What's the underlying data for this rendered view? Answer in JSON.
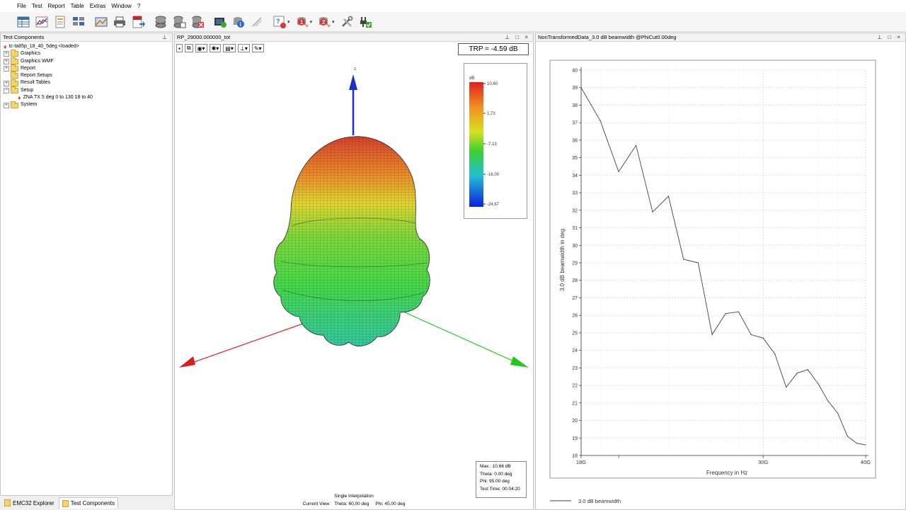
{
  "menu": [
    "File",
    "Test",
    "Report",
    "Table",
    "Extras",
    "Window",
    "?"
  ],
  "toolbar": {
    "icons": [
      "table-icon",
      "line-chart-icon",
      "report-icon",
      "tree-table-icon",
      "image-chart-icon",
      "print-icon",
      "export-pdf-icon",
      "database-icon",
      "database-edit-icon",
      "database-delete-icon",
      "monitor-run-icon",
      "info-db-icon",
      "signal-icon",
      "checklist-icon",
      "step-one-icon",
      "step-two-icon",
      "tools-icon",
      "plug-icon"
    ]
  },
  "left_panel": {
    "title": "Test Components",
    "tree": [
      {
        "label": "tc-ta85p_18_40_5deg <loaded>",
        "level": 0,
        "type": "root"
      },
      {
        "label": "Graphics",
        "level": 0,
        "type": "folder",
        "expander": "+"
      },
      {
        "label": "Graphics WMF",
        "level": 0,
        "type": "folder",
        "expander": "+"
      },
      {
        "label": "Report",
        "level": 0,
        "type": "folder",
        "expander": "+"
      },
      {
        "label": "Report Setups",
        "level": 0,
        "type": "folder",
        "expander": ""
      },
      {
        "label": "Result Tables",
        "level": 0,
        "type": "folder",
        "expander": "+"
      },
      {
        "label": "Setup",
        "level": 0,
        "type": "folder",
        "expander": "−"
      },
      {
        "label": "ZNA TX 5 deg 0 to 130 18 to 40",
        "level": 1,
        "type": "root"
      },
      {
        "label": "System",
        "level": 0,
        "type": "folder",
        "expander": "+"
      }
    ],
    "tabs": [
      "EMC32 Explorer",
      "Test Components"
    ]
  },
  "middle_panel": {
    "title": "RP_29000.000000_tot",
    "trp": "TRP = -4.59 dB",
    "axis_z": "z",
    "legend": {
      "unit": "dB",
      "ticks": [
        "10,60",
        "1,73",
        "-7,13",
        "-16,00",
        "-24,87"
      ]
    },
    "info": {
      "max": "Max.: 10.66 dB",
      "theta": "Theta: 0.00 deg",
      "phi": "Phi: 95.00 deg",
      "time": "Test Time: 00:04:20"
    },
    "interpolation": "Single Interpolation",
    "view_label": "Current View:",
    "view_theta": "Theta: 60,00 deg",
    "view_phi": "Phi: 45,00 deg"
  },
  "right_panel": {
    "title": "NonTransformedData_3.0 dB beamwidth @PhiCut0.00deg"
  },
  "chart_data": {
    "type": "line",
    "title": "",
    "xlabel": "Frequency in Hz",
    "ylabel": "3.0 dB beamwidth in deg",
    "x_scale": "log",
    "xlim": [
      18,
      40
    ],
    "x_unit": "GHz",
    "x_ticks": [
      "18G",
      "30G",
      "40G"
    ],
    "ylim": [
      18,
      40
    ],
    "y_ticks": [
      18,
      19,
      20,
      21,
      22,
      23,
      24,
      25,
      26,
      27,
      28,
      29,
      30,
      31,
      32,
      33,
      34,
      35,
      36,
      37,
      38,
      39,
      40
    ],
    "grid": true,
    "legend_position": "bottom-left",
    "series": [
      {
        "name": "3.0 dB beamwidth",
        "color": "#404040",
        "x": [
          18,
          19,
          20,
          21,
          22,
          23,
          24,
          25,
          26,
          27,
          28,
          29,
          30,
          31,
          32,
          33,
          34,
          35,
          36,
          37,
          38,
          39,
          40
        ],
        "values": [
          39.0,
          37.1,
          34.2,
          35.7,
          31.9,
          32.8,
          29.2,
          29.0,
          24.9,
          26.1,
          26.2,
          24.9,
          24.7,
          23.8,
          21.9,
          22.7,
          22.9,
          22.1,
          21.1,
          20.4,
          19.1,
          18.7,
          18.6
        ]
      }
    ]
  }
}
